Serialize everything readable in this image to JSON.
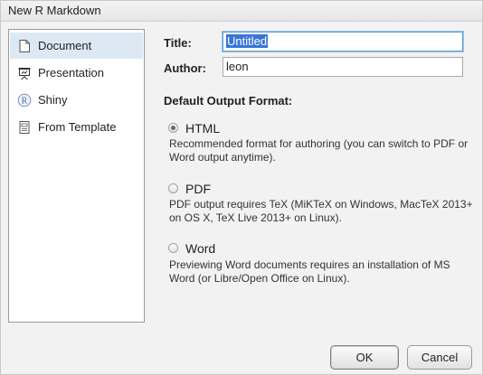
{
  "window": {
    "title": "New R Markdown"
  },
  "sidebar": {
    "items": [
      {
        "label": "Document",
        "icon": "document-icon",
        "selected": true
      },
      {
        "label": "Presentation",
        "icon": "presentation-icon",
        "selected": false
      },
      {
        "label": "Shiny",
        "icon": "shiny-icon",
        "selected": false
      },
      {
        "label": "From Template",
        "icon": "template-icon",
        "selected": false
      }
    ]
  },
  "form": {
    "title_label": "Title:",
    "title_value": "Untitled",
    "author_label": "Author:",
    "author_value": "leon"
  },
  "output": {
    "section_title": "Default Output Format:",
    "options": [
      {
        "label": "HTML",
        "selected": true,
        "description": "Recommended format for authoring (you can switch to PDF or Word output anytime)."
      },
      {
        "label": "PDF",
        "selected": false,
        "description": "PDF output requires TeX (MiKTeX on Windows, MacTeX 2013+ on OS X, TeX Live 2013+ on Linux)."
      },
      {
        "label": "Word",
        "selected": false,
        "description": "Previewing Word documents requires an installation of MS Word (or Libre/Open Office on Linux)."
      }
    ]
  },
  "buttons": {
    "ok": "OK",
    "cancel": "Cancel"
  },
  "colors": {
    "selection_bg": "#dce9f5",
    "text_selection": "#3875d7",
    "focus_border": "#5b9bd5"
  }
}
